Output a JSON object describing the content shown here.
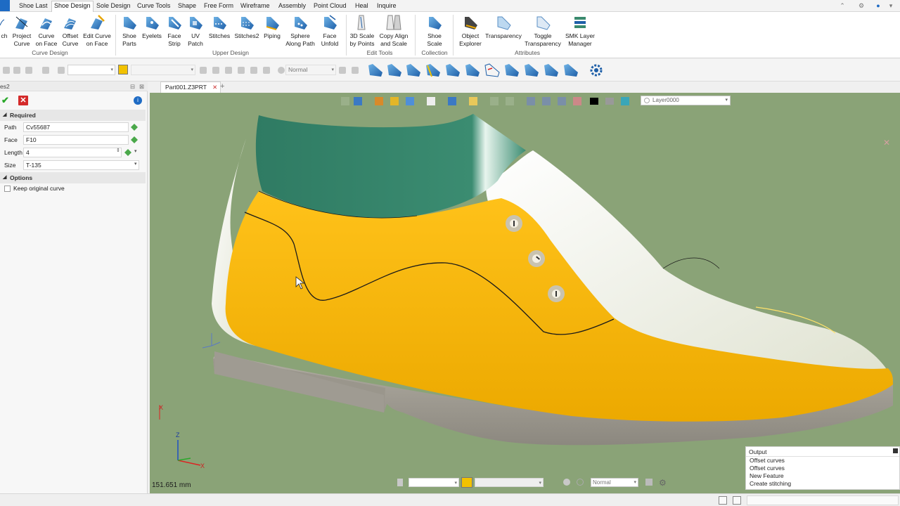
{
  "menu": {
    "tabs": [
      "Shoe Last",
      "Shoe Design",
      "Sole Design",
      "Curve Tools",
      "Shape",
      "Free Form",
      "Wireframe",
      "Assembly",
      "Point Cloud",
      "Heal",
      "Inquire"
    ],
    "active": "Shoe Design"
  },
  "ribbon": {
    "buttons": [
      {
        "line1": "ch",
        "line2": ""
      },
      {
        "line1": "Project",
        "line2": "Curve"
      },
      {
        "line1": "Curve",
        "line2": "on Face"
      },
      {
        "line1": "Offset",
        "line2": "Curve"
      },
      {
        "line1": "Edit Curve",
        "line2": "on Face"
      },
      {
        "line1": "Shoe",
        "line2": "Parts"
      },
      {
        "line1": "Eyelets",
        "line2": ""
      },
      {
        "line1": "Face",
        "line2": "Strip"
      },
      {
        "line1": "UV",
        "line2": "Patch"
      },
      {
        "line1": "Stitches",
        "line2": ""
      },
      {
        "line1": "Stitches2",
        "line2": ""
      },
      {
        "line1": "Piping",
        "line2": ""
      },
      {
        "line1": "Sphere",
        "line2": "Along Path"
      },
      {
        "line1": "Face",
        "line2": "Unfold"
      },
      {
        "line1": "3D Scale",
        "line2": "by Points"
      },
      {
        "line1": "Copy Align",
        "line2": "and Scale"
      },
      {
        "line1": "Shoe",
        "line2": "Scale"
      },
      {
        "line1": "Object",
        "line2": "Explorer"
      },
      {
        "line1": "Transparency",
        "line2": ""
      },
      {
        "line1": "Toggle",
        "line2": "Transparency"
      },
      {
        "line1": "SMK Layer",
        "line2": "Manager"
      }
    ],
    "groups": [
      "Curve Design",
      "Upper Design",
      "Edit Tools",
      "Collection",
      "Attributes"
    ]
  },
  "toolstrip": {
    "normal_label": "Normal"
  },
  "panel": {
    "title": "es2",
    "required_label": "Required",
    "fields": [
      {
        "label": "Path",
        "value": "Cv55687"
      },
      {
        "label": "Face",
        "value": "F10"
      },
      {
        "label": "Length",
        "value": "4"
      },
      {
        "label": "Size",
        "value": "T-135"
      }
    ],
    "options_label": "Options",
    "checkbox_label": "Keep original curve"
  },
  "document": {
    "tab_label": "Part001.Z3PRT",
    "layer": "Layer0000",
    "scale_readout": "151.651 mm",
    "bottom_normal": "Normal"
  },
  "axes": {
    "x": "X",
    "z": "Z"
  },
  "output": {
    "title": "Output",
    "lines": [
      "Offset curves",
      "Offset curves",
      "New Feature",
      "Create stitching"
    ]
  },
  "colors": {
    "viewport_bg": "#8aa377",
    "upper_yellow": "#f5b400",
    "collar_green": "#3a8a6e",
    "vamp_cream": "#eceee0",
    "sole_grey": "#9f9b92",
    "accent_blue": "#1e6bc4"
  }
}
